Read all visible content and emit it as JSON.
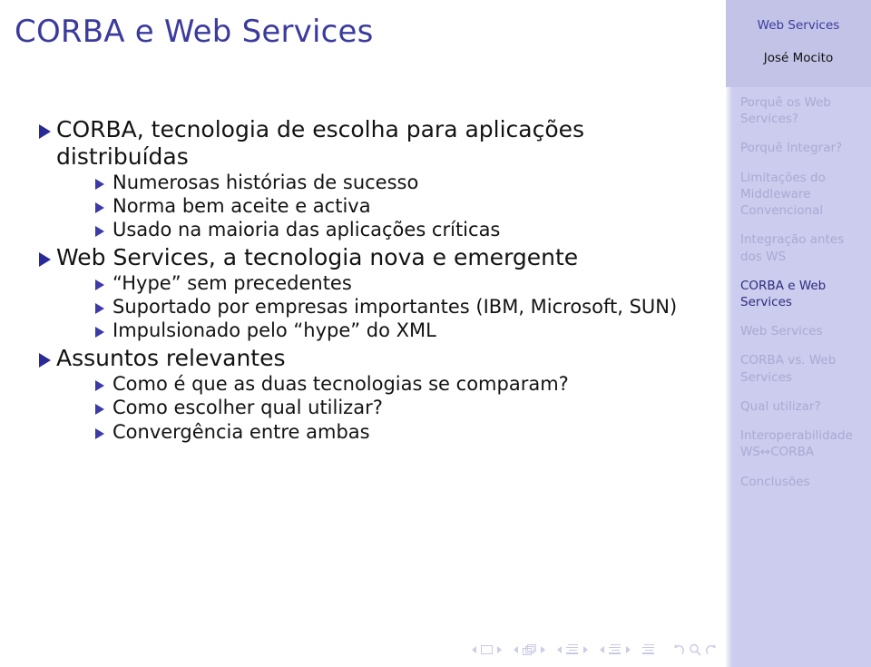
{
  "slide": {
    "title": "CORBA e Web Services",
    "title_color": "#3b3b9e",
    "bullet_color": "#2a2a96",
    "background": "#ffffff"
  },
  "content": {
    "items": [
      {
        "level": 1,
        "text": "CORBA, tecnologia de escolha para aplicações distribuídas",
        "children": [
          {
            "level": 2,
            "text": "Numerosas histórias de sucesso"
          },
          {
            "level": 2,
            "text": "Norma bem aceite e activa"
          },
          {
            "level": 2,
            "text": "Usado na maioria das aplicações críticas"
          }
        ]
      },
      {
        "level": 1,
        "text": "Web Services, a tecnologia nova e emergente",
        "children": [
          {
            "level": 2,
            "text": "“Hype” sem precedentes"
          },
          {
            "level": 2,
            "text": "Suportado por empresas importantes (IBM, Microsoft, SUN)"
          },
          {
            "level": 2,
            "text": "Impulsionado pelo “hype” do XML"
          }
        ]
      },
      {
        "level": 1,
        "text": "Assuntos relevantes",
        "children": [
          {
            "level": 2,
            "text": "Como é que as duas tecnologias se comparam?"
          },
          {
            "level": 2,
            "text": "Como escolher qual utilizar?"
          },
          {
            "level": 2,
            "text": "Convergência entre ambas"
          }
        ]
      }
    ]
  },
  "sidebar": {
    "background": "#ccccee",
    "header_background": "#c3c3e8",
    "title": "Web Services",
    "author": "José Mocito",
    "active_color": "#2c2c7e",
    "inactive_color": "#a9a9d4",
    "items": [
      {
        "label": "Porquê os Web Services?",
        "active": false
      },
      {
        "label": "Porquê Integrar?",
        "active": false
      },
      {
        "label": "Limitações do Middleware Convencional",
        "active": false
      },
      {
        "label": "Integração antes dos WS",
        "active": false
      },
      {
        "label": "CORBA e Web Services",
        "active": true
      },
      {
        "label": "Web Services",
        "active": false
      },
      {
        "label": "CORBA vs. Web Services",
        "active": false
      },
      {
        "label": "Qual utilizar?",
        "active": false
      },
      {
        "label": "Interoperabilidade WS↔CORBA",
        "active": false
      },
      {
        "label": "Conclusões",
        "active": false
      }
    ]
  },
  "navigation": {
    "color": "#c9c9e6",
    "groups": [
      {
        "name": "slide-navigation",
        "prev": "◀",
        "icon": "slide-icon",
        "next": "▶"
      },
      {
        "name": "frame-navigation",
        "prev": "◀",
        "icon": "frames-icon",
        "next": "▶"
      },
      {
        "name": "subsection-navigation",
        "prev": "◀",
        "icon": "subsection-icon",
        "next": "▶"
      },
      {
        "name": "section-navigation",
        "prev": "◀",
        "icon": "section-icon",
        "next": "▶"
      },
      {
        "name": "presentation-navigation",
        "prev": "",
        "icon": "presentation-icon",
        "next": ""
      }
    ],
    "history": [
      {
        "name": "back-icon"
      },
      {
        "name": "search-icon"
      },
      {
        "name": "forward-icon"
      }
    ]
  }
}
